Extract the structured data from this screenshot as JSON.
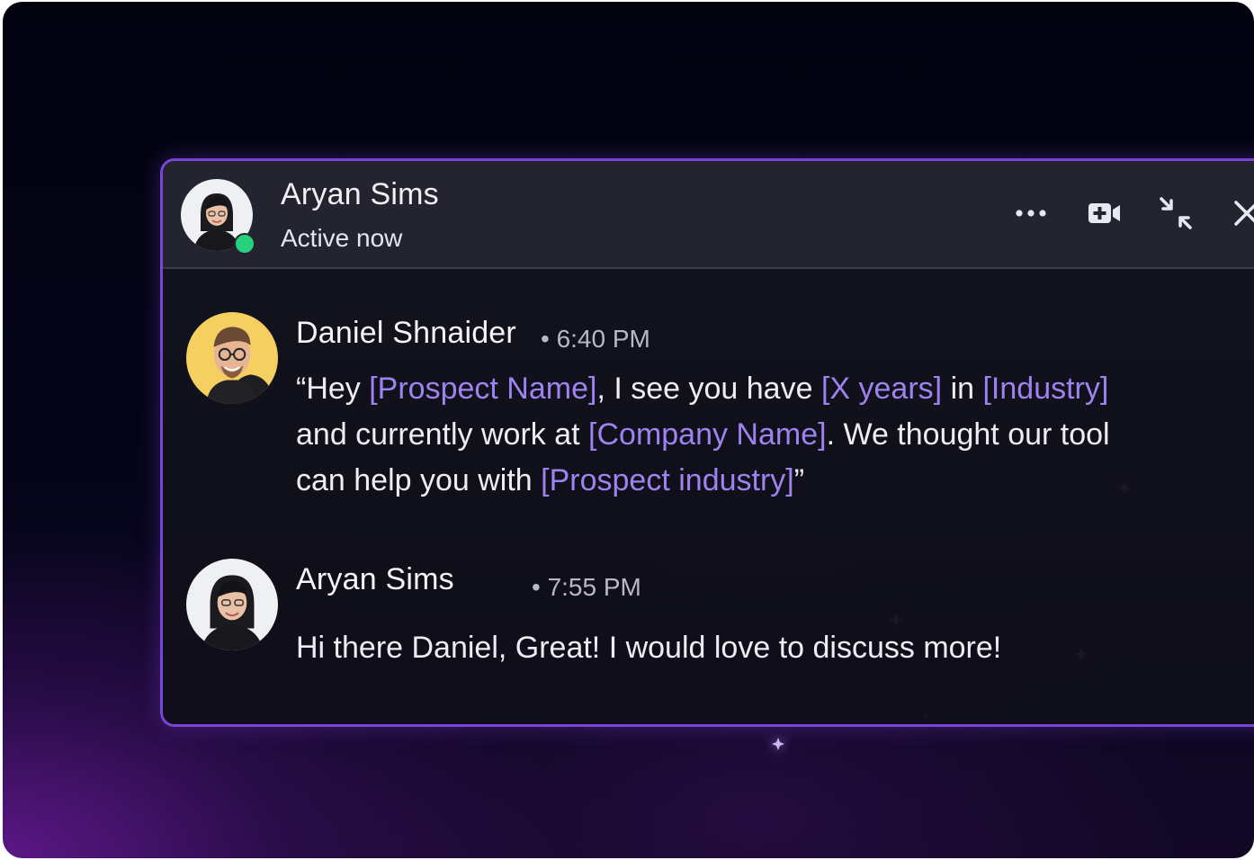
{
  "conversation": {
    "contact_name": "Aryan Sims",
    "status": "Active now",
    "status_color": "#27d07a"
  },
  "toolbar": {
    "more_icon": "more-horizontal-icon",
    "video_icon": "video-add-icon",
    "minimize_icon": "minimize-arrows-icon",
    "close_icon": "close-icon"
  },
  "messages": [
    {
      "sender": "Daniel Shnaider",
      "time": "• 6:40 PM",
      "avatar_bg": "#f5d061",
      "parts": [
        {
          "text": "“Hey ",
          "type": "plain"
        },
        {
          "text": "[Prospect Name]",
          "type": "placeholder"
        },
        {
          "text": ", I see you have ",
          "type": "plain"
        },
        {
          "text": "[X years]",
          "type": "placeholder"
        },
        {
          "text": " in ",
          "type": "plain"
        },
        {
          "text": "[Industry]",
          "type": "placeholder"
        },
        {
          "text": " and currently work at ",
          "type": "plain"
        },
        {
          "text": "[Company Name]",
          "type": "placeholder"
        },
        {
          "text": ". We thought our tool can help you with ",
          "type": "plain"
        },
        {
          "text": "[Prospect industry]",
          "type": "placeholder"
        },
        {
          "text": "”",
          "type": "plain"
        }
      ]
    },
    {
      "sender": "Aryan Sims",
      "time": "• 7:55 PM",
      "avatar_bg": "#eef0f4",
      "text": "Hi there Daniel, Great! I would love to discuss more!"
    }
  ],
  "colors": {
    "accent_border": "#7a44d6",
    "placeholder_text": "#9d82f0",
    "header_bg": "#232430"
  }
}
